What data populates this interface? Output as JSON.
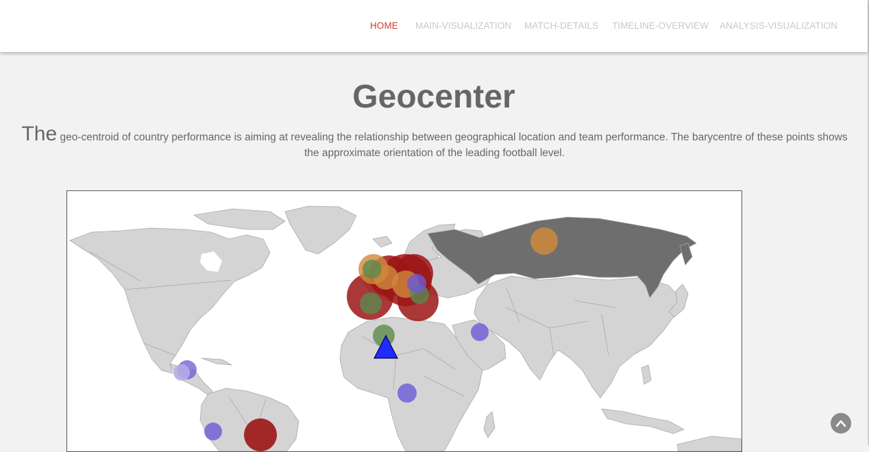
{
  "nav": {
    "items": [
      {
        "label": "HOME",
        "active": true
      },
      {
        "label": "MAIN-VISUALIZATION",
        "active": false
      },
      {
        "label": "MATCH-DETAILS",
        "active": false
      },
      {
        "label": "TIMELINE-OVERVIEW",
        "active": false
      },
      {
        "label": "ANALYSIS-VISUALIZATION",
        "active": false
      }
    ]
  },
  "page": {
    "title": "Geocenter",
    "intro_lead": "The",
    "intro_text": " geo-centroid of country performance is aiming at revealing the relationship between geographical location and team performance. The barycentre of these points shows the approximate orientation of the leading football level."
  },
  "map": {
    "colors": {
      "land": "#d4d4d4",
      "highlight": "#6e6e6e",
      "border": "#a8a8a8",
      "barycentre": "#1f2bff",
      "red": "#9c1515",
      "orange": "#cf8a3c",
      "green": "#5b8a4e",
      "purple": "#6b5ad6",
      "lavender": "#b9aee8"
    },
    "highlighted_country": "Russia",
    "barycentre_marker": "blue-triangle-icon",
    "to_top_icon": "chevron-up-icon"
  }
}
